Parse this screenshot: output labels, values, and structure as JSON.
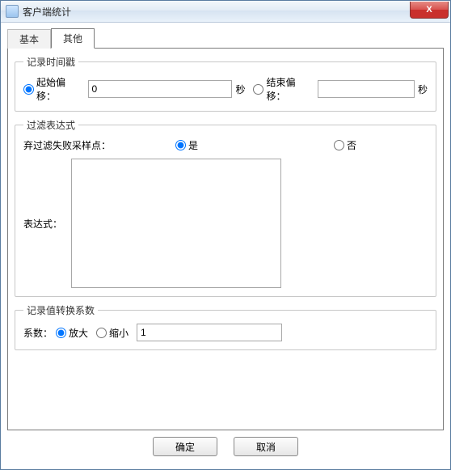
{
  "window": {
    "title": "客户端统计"
  },
  "tabs": {
    "basic": "基本",
    "other": "其他"
  },
  "group_timestamp": {
    "legend": "记录时间戳",
    "start_offset_label": "起始偏移：",
    "start_offset_value": "0",
    "seconds": "秒",
    "end_offset_label": "结束偏移：",
    "end_offset_value": ""
  },
  "group_filter": {
    "legend": "过滤表达式",
    "discard_label": "弃过滤失败采样点：",
    "yes": "是",
    "no": "否",
    "expr_label": "表达式：",
    "expr_value": ""
  },
  "group_coeff": {
    "legend": "记录值转换系数",
    "coeff_label": "系数：",
    "enlarge": "放大",
    "shrink": "缩小",
    "coeff_value": "1"
  },
  "buttons": {
    "ok": "确定",
    "cancel": "取消"
  },
  "icons": {
    "close": "X"
  }
}
